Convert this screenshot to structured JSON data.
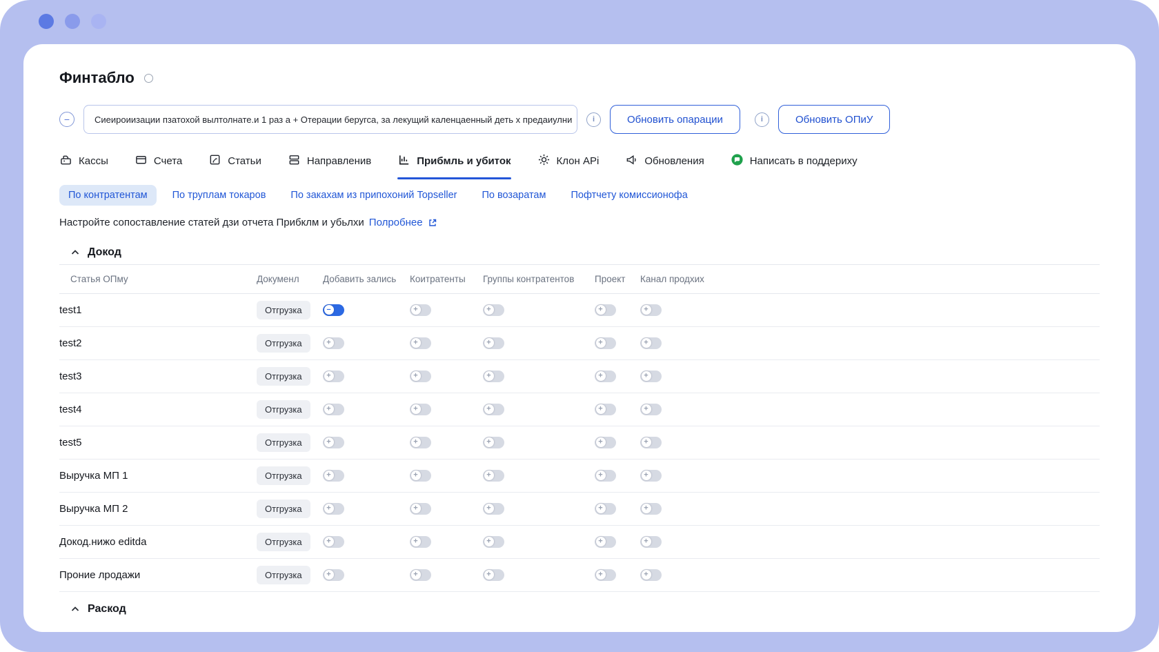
{
  "accent": "#2456d8",
  "window": {
    "title": "Финтабло"
  },
  "banner": {
    "text": "Сиеироиизации пзатохой вылтолнате.и 1 раз а + Отерации беругса, за лекущий каленцаенный деть х предаиулни",
    "update_operations_label": "Обновить опарации",
    "update_opiu_label": "Обновить ОПиУ"
  },
  "tabs": {
    "active": "Прибмль и убиток",
    "items": [
      {
        "label": "Кассы",
        "icon": "cash-register-icon"
      },
      {
        "label": "Счета",
        "icon": "accounts-icon"
      },
      {
        "label": "Статьи",
        "icon": "articles-icon"
      },
      {
        "label": "Направленив",
        "icon": "directions-icon"
      },
      {
        "label": "Прибмль и убиток",
        "icon": "profit-loss-chart-icon"
      },
      {
        "label": "Клон APi",
        "icon": "gear-icon"
      },
      {
        "label": "Обновления",
        "icon": "megaphone-icon"
      },
      {
        "label": "Написать в поддериху",
        "icon": "support-chat-icon"
      }
    ]
  },
  "subtabs": {
    "active": "По контратентам",
    "items": [
      {
        "label": "По контратентам"
      },
      {
        "label": "По труплам токаров"
      },
      {
        "label": "По закахам из припохоний Topseller"
      },
      {
        "label": "По возаратам"
      },
      {
        "label": "Пофтчету комиссионофа"
      }
    ]
  },
  "note": {
    "text": "Настройте сопоставление статей дзи отчета Прибклм и убьлхи",
    "link": "Полробнее"
  },
  "sections": {
    "income": {
      "label": "Докод"
    },
    "expense": {
      "label": "Раскод"
    }
  },
  "table": {
    "headers": [
      "Статья ОПму",
      "Докуменл",
      "Добавить зались",
      "Коитратенты",
      "Группы контратентов",
      "Проект",
      "Канал продхих"
    ],
    "rows": [
      {
        "name": "test1",
        "document": "Отгрузка",
        "toggles": [
          true,
          false,
          false,
          false,
          false
        ]
      },
      {
        "name": "test2",
        "document": "Отгрузка",
        "toggles": [
          false,
          false,
          false,
          false,
          false
        ]
      },
      {
        "name": "test3",
        "document": "Отгрузка",
        "toggles": [
          false,
          false,
          false,
          false,
          false
        ]
      },
      {
        "name": "test4",
        "document": "Отгрузка",
        "toggles": [
          false,
          false,
          false,
          false,
          false
        ]
      },
      {
        "name": "test5",
        "document": "Отгрузка",
        "toggles": [
          false,
          false,
          false,
          false,
          false
        ]
      },
      {
        "name": "Выручка МП 1",
        "document": "Отгрузка",
        "toggles": [
          false,
          false,
          false,
          false,
          false
        ]
      },
      {
        "name": "Выручка МП 2",
        "document": "Отгрузка",
        "toggles": [
          false,
          false,
          false,
          false,
          false
        ]
      },
      {
        "name": "Докод.нижо editda",
        "document": "Отгрузка",
        "toggles": [
          false,
          false,
          false,
          false,
          false
        ]
      },
      {
        "name": "Проние лродажи",
        "document": "Отгрузка",
        "toggles": [
          false,
          false,
          false,
          false,
          false
        ]
      }
    ],
    "toggle_on_sign": "–",
    "toggle_off_sign": "+"
  }
}
